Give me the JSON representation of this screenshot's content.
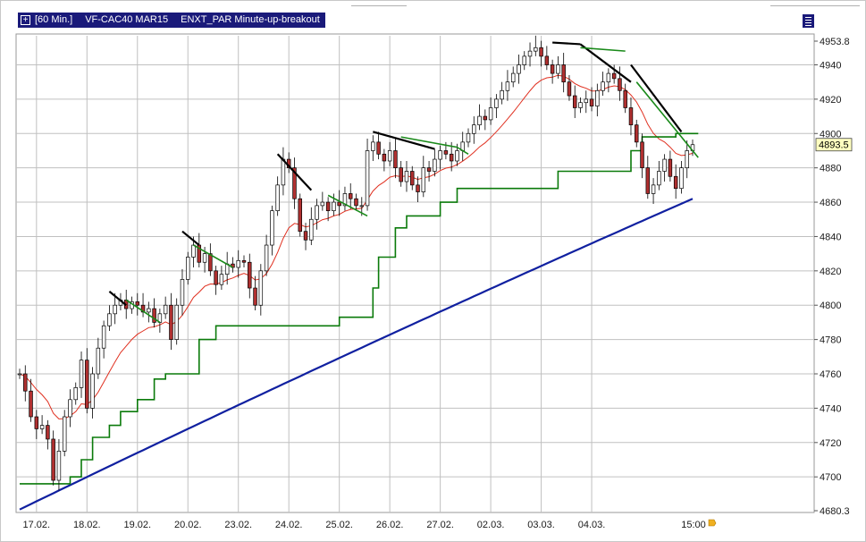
{
  "window": {
    "title_interval": "[60 Min.]",
    "title_symbol": "VF-CAC40 MAR15",
    "title_strategy": "ENXT_PAR Minute-up-breakout",
    "menu_icon": "list-menu-icon",
    "expand_icon": "plus-box-icon"
  },
  "colors": {
    "background": "#ffffff",
    "grid": "#c0c0c0",
    "candle_up": "#ffffff",
    "candle_down": "#b03030",
    "candle_outline": "#000000",
    "ma_red": "#e03020",
    "ma_blue": "#1020a0",
    "stop_green": "#0a7a0a",
    "trend_black": "#000000",
    "trend_green": "#1a8a1a",
    "title_bg": "#1a1a7a"
  },
  "chart_data": {
    "type": "candlestick",
    "x_ticks": [
      "17.02.",
      "18.02.",
      "19.02.",
      "20.02.",
      "23.02.",
      "24.02.",
      "25.02.",
      "26.02.",
      "27.02.",
      "02.03.",
      "03.03.",
      "04.03."
    ],
    "x_last_label": "15:00",
    "y_ticks": [
      4680.3,
      4700,
      4720,
      4740,
      4760,
      4780,
      4800,
      4820,
      4840,
      4860,
      4880,
      4900,
      4920,
      4940,
      4953.8
    ],
    "ylim": [
      4680.3,
      4953.8
    ],
    "current_price": "4893.5",
    "bars_per_day": 9,
    "closes": [
      4760,
      4750,
      4735,
      4728,
      4730,
      4722,
      4698,
      4715,
      4735,
      4745,
      4752,
      4768,
      4740,
      4760,
      4775,
      4788,
      4795,
      4800,
      4803,
      4798,
      4802,
      4800,
      4796,
      4798,
      4790,
      4795,
      4800,
      4780,
      4800,
      4815,
      4828,
      4835,
      4825,
      4830,
      4820,
      4812,
      4818,
      4824,
      4822,
      4826,
      4825,
      4810,
      4800,
      4820,
      4835,
      4855,
      4870,
      4885,
      4880,
      4862,
      4843,
      4838,
      4850,
      4858,
      4860,
      4855,
      4860,
      4858,
      4865,
      4862,
      4858,
      4858,
      4890,
      4895,
      4888,
      4884,
      4890,
      4880,
      4872,
      4878,
      4870,
      4866,
      4880,
      4878,
      4885,
      4890,
      4888,
      4884,
      4890,
      4895,
      4900,
      4905,
      4910,
      4908,
      4915,
      4920,
      4925,
      4930,
      4935,
      4940,
      4945,
      4948,
      4950,
      4945,
      4940,
      4935,
      4940,
      4930,
      4922,
      4915,
      4918,
      4920,
      4916,
      4925,
      4930,
      4935,
      4932,
      4925,
      4915,
      4905,
      4895,
      4880,
      4865,
      4870,
      4878,
      4885,
      4875,
      4868,
      4880,
      4890,
      4893.5
    ],
    "stop_levels": [
      {
        "from": 0,
        "to": 9,
        "value": 4696
      },
      {
        "from": 9,
        "to": 11,
        "value": 4700
      },
      {
        "from": 11,
        "to": 13,
        "value": 4710
      },
      {
        "from": 13,
        "to": 16,
        "value": 4723
      },
      {
        "from": 16,
        "to": 18,
        "value": 4730
      },
      {
        "from": 18,
        "to": 21,
        "value": 4738
      },
      {
        "from": 21,
        "to": 24,
        "value": 4745
      },
      {
        "from": 24,
        "to": 26,
        "value": 4757
      },
      {
        "from": 26,
        "to": 32,
        "value": 4760
      },
      {
        "from": 32,
        "to": 35,
        "value": 4780
      },
      {
        "from": 35,
        "to": 57,
        "value": 4788
      },
      {
        "from": 57,
        "to": 63,
        "value": 4793
      },
      {
        "from": 63,
        "to": 64,
        "value": 4810
      },
      {
        "from": 64,
        "to": 67,
        "value": 4828
      },
      {
        "from": 67,
        "to": 69,
        "value": 4845
      },
      {
        "from": 69,
        "to": 75,
        "value": 4852
      },
      {
        "from": 75,
        "to": 78,
        "value": 4860
      },
      {
        "from": 78,
        "to": 96,
        "value": 4868
      },
      {
        "from": 96,
        "to": 109,
        "value": 4878
      },
      {
        "from": 109,
        "to": 111,
        "value": 4890
      },
      {
        "from": 111,
        "to": 117,
        "value": 4898
      },
      {
        "from": 117,
        "to": 121,
        "value": 4900
      }
    ],
    "blue_ma": {
      "start": 4681,
      "end": 4862
    },
    "trend_lines_black": [
      {
        "i0": 16,
        "v0": 4808,
        "i1": 19,
        "v1": 4800
      },
      {
        "i0": 29,
        "v0": 4843,
        "i1": 32,
        "v1": 4835
      },
      {
        "i0": 46,
        "v0": 4888,
        "i1": 52,
        "v1": 4867
      },
      {
        "i0": 63,
        "v0": 4901,
        "i1": 74,
        "v1": 4891
      },
      {
        "i0": 95,
        "v0": 4953,
        "i1": 100,
        "v1": 4952
      },
      {
        "i0": 100,
        "v0": 4952,
        "i1": 109,
        "v1": 4930
      },
      {
        "i0": 109,
        "v0": 4940,
        "i1": 118,
        "v1": 4901
      }
    ],
    "trend_lines_green": [
      {
        "i0": 19,
        "v0": 4803,
        "i1": 25,
        "v1": 4790
      },
      {
        "i0": 31,
        "v0": 4835,
        "i1": 38,
        "v1": 4822
      },
      {
        "i0": 55,
        "v0": 4864,
        "i1": 62,
        "v1": 4852
      },
      {
        "i0": 68,
        "v0": 4898,
        "i1": 78,
        "v1": 4892
      },
      {
        "i0": 78,
        "v0": 4892,
        "i1": 80,
        "v1": 4888
      },
      {
        "i0": 100,
        "v0": 4950,
        "i1": 108,
        "v1": 4948
      },
      {
        "i0": 110,
        "v0": 4930,
        "i1": 121,
        "v1": 4886
      }
    ]
  }
}
